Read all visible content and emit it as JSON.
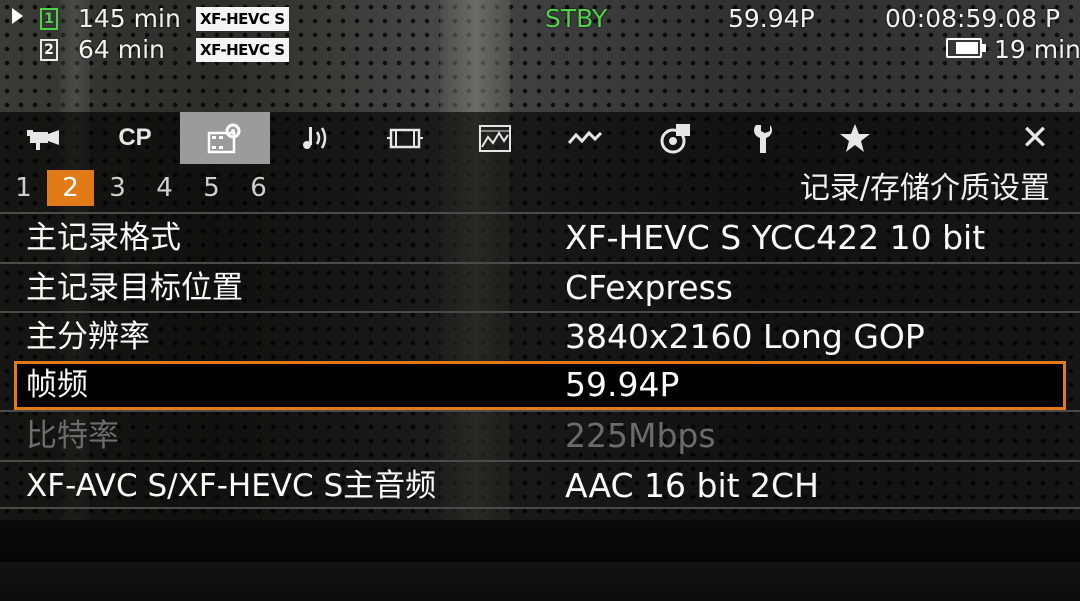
{
  "status": {
    "slot1": {
      "number": "1",
      "time": "145 min",
      "codec": "XF-HEVC S"
    },
    "slot2": {
      "number": "2",
      "time": "64 min",
      "codec": "XF-HEVC S"
    },
    "state": "STBY",
    "frame_rate": "59.94P",
    "timecode": "00:08:59.08 P",
    "battery_time": "19 min",
    "battery_level": 0.8
  },
  "tabs": [
    {
      "name": "camera-icon"
    },
    {
      "name": "cp-icon",
      "text": "CP"
    },
    {
      "name": "recording-setup-icon",
      "active": true
    },
    {
      "name": "audio-icon"
    },
    {
      "name": "display-icon"
    },
    {
      "name": "waveform-icon"
    },
    {
      "name": "custom-picture-icon"
    },
    {
      "name": "assign-icon"
    },
    {
      "name": "wrench-icon"
    },
    {
      "name": "star-icon"
    }
  ],
  "close_icon": "✕",
  "pages": [
    "1",
    "2",
    "3",
    "4",
    "5",
    "6"
  ],
  "active_page": "2",
  "menu_title": "记录/存储介质设置",
  "rows": [
    {
      "label": "主记录格式",
      "value": "XF-HEVC S YCC422 10 bit"
    },
    {
      "label": "主记录目标位置",
      "value": "CFexpress"
    },
    {
      "label": "主分辨率",
      "value": "3840x2160 Long GOP"
    },
    {
      "label": "帧频",
      "value": "59.94P",
      "selected": true
    },
    {
      "label": "比特率",
      "value": "225Mbps",
      "disabled": true
    },
    {
      "label": "XF-AVC S/XF-HEVC S主音频",
      "value": "AAC 16 bit 2CH"
    }
  ],
  "colors": {
    "accent": "#e07b17",
    "status_green": "#4fd24a",
    "tab_active": "#9b9b9b"
  }
}
